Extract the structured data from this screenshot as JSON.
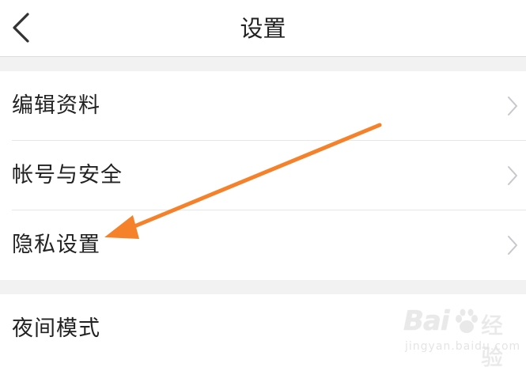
{
  "header": {
    "title": "设置",
    "back_icon": "chevron-left-icon"
  },
  "settings_groups": [
    {
      "items": [
        {
          "label": "编辑资料",
          "icon": "chevron-right-icon"
        },
        {
          "label": "帐号与安全",
          "icon": "chevron-right-icon"
        },
        {
          "label": "隐私设置",
          "icon": "chevron-right-icon"
        }
      ]
    },
    {
      "items": [
        {
          "label": "夜间模式"
        }
      ]
    }
  ],
  "annotation": {
    "type": "arrow",
    "color": "#f5822a",
    "points_to": "隐私设置"
  },
  "watermark": {
    "brand_prefix": "Bai",
    "brand_suffix": "经验",
    "subtext": "jingyan.baidu.com"
  },
  "colors": {
    "background": "#f2f2f2",
    "surface": "#ffffff",
    "text": "#222222",
    "divider": "#e6e6e6",
    "chevron": "#c7c7cc"
  }
}
